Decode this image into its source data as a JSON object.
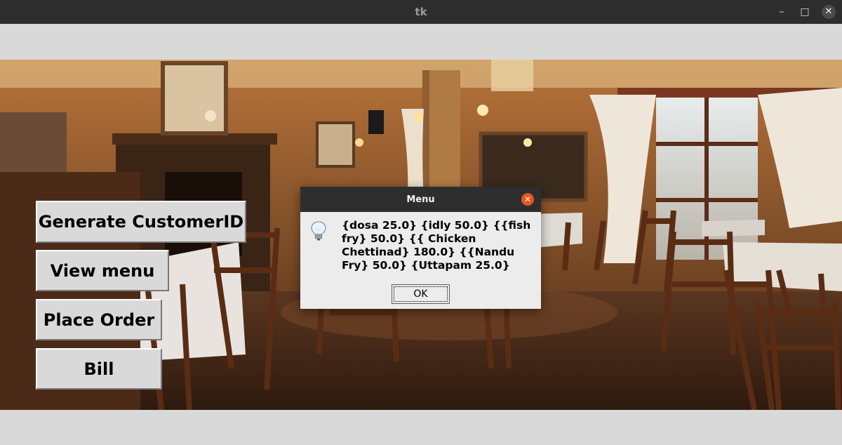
{
  "window": {
    "title": "tk",
    "controls": {
      "minimize": "–",
      "maximize": "□",
      "close": "✕"
    }
  },
  "buttons": {
    "generate_customer_id": "Generate CustomerID",
    "view_menu": "View menu",
    "place_order": "Place Order",
    "bill": "Bill"
  },
  "dialog": {
    "title": "Menu",
    "icon": "info-lightbulb-icon",
    "message": "{dosa 25.0} {idly 50.0} {{fish fry} 50.0} {{ Chicken Chettinad} 180.0} {{Nandu Fry} 50.0} {Uttapam 25.0}",
    "ok_label": "OK"
  },
  "colors": {
    "titlebar": "#2d2d2d",
    "window_bg": "#d9d9d9",
    "dialog_close": "#e95420"
  }
}
